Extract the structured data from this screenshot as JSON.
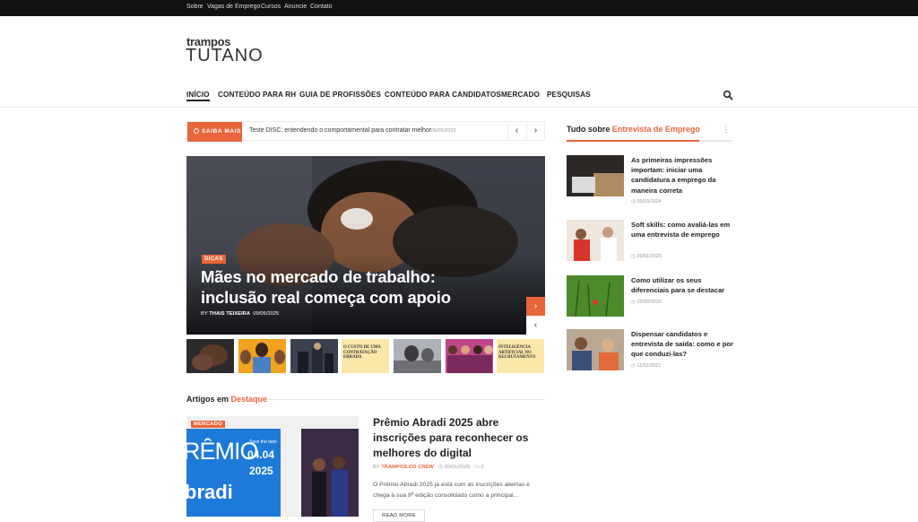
{
  "topbar": {
    "links": [
      "Sobre",
      "Vagas de Emprego",
      "Cursos",
      "Anuncie",
      "Contato"
    ]
  },
  "logo": {
    "line1": "trampos",
    "line2": "TUTANO"
  },
  "nav": {
    "items": [
      "INÍCIO",
      "CONTEÚDO PARA RH",
      "GUIA DE PROFISSÕES",
      "CONTEÚDO PARA CANDIDATOS",
      "MERCADO",
      "PESQUISAS"
    ],
    "search_icon": "search-icon"
  },
  "ticker": {
    "label": "SAIBA MAIS",
    "title": "Teste DISC: entendendo o comportamental para contratar melhor",
    "date": "06/05/2025",
    "prev": "‹",
    "next": "›"
  },
  "hero": {
    "category": "DICAS",
    "title": "Mães no mercado de trabalho: inclusão real começa com apoio",
    "by": "BY",
    "author": "THAIS TEIXEIRA",
    "date": "09/05/2025",
    "next": "›",
    "prev": "‹"
  },
  "thumbs": {
    "t4": "O CUSTO DE UMA CONTRATAÇÃO ERRADA",
    "t7": "INTELIGÊNCIA ARTIFICIAL NO RECRUTAMENTO"
  },
  "section": {
    "prefix": "Artigos em",
    "highlight": "Destaque"
  },
  "featured": {
    "category": "MERCADO",
    "title": "Prêmio Abradi 2025 abre inscrições para reconhecer os melhores do digital",
    "by": "BY",
    "author": "TRAMPOS.CO CREW",
    "date": "30/01/2025",
    "comments": "0",
    "excerpt": "O Prêmio Abradi 2025 já está com as inscrições abertas e chega à sua 9ª edição consolidado como a principal...",
    "read_more": "READ MORE",
    "image_text": {
      "big": "RÊMIO",
      "brand": "bradi",
      "save": "Save the date",
      "day": "04.04",
      "year": "2025"
    }
  },
  "sidebar": {
    "prefix": "Tudo sobre",
    "highlight": "Entrevista de Emprego",
    "menu": "⋮",
    "items": [
      {
        "title": "As primeiras impressões importam: iniciar uma candidatura a emprego da maneira correta",
        "date": "05/03/2024"
      },
      {
        "title": "Soft skills: como avaliá-las em uma entrevista de emprego",
        "date": "26/01/2025"
      },
      {
        "title": "Como utilizar os seus diferenciais para se destacar",
        "date": "22/09/2020"
      },
      {
        "title": "Dispensar candidatos e entrevista de saída: como e por que conduzi-las?",
        "date": "11/01/2021"
      }
    ]
  },
  "colors": {
    "accent": "#e8653a",
    "topbar": "#111111"
  }
}
